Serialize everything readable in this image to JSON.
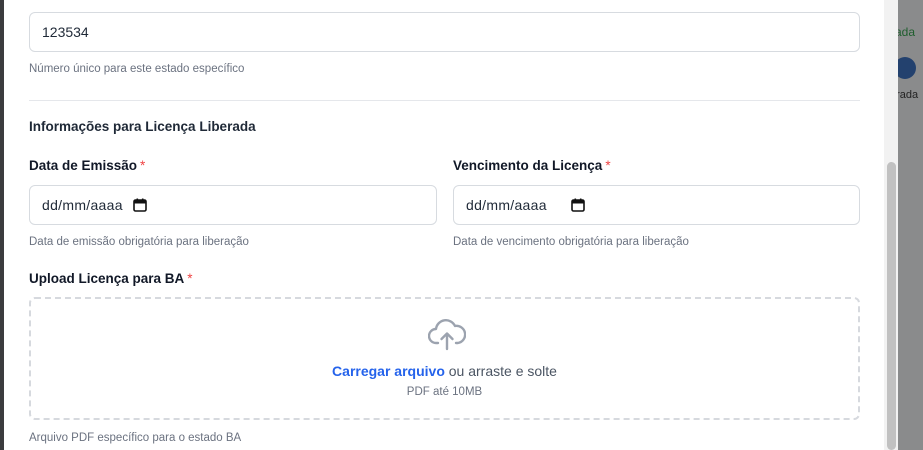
{
  "background": {
    "right_text_1": "ada",
    "right_text_2": "erada"
  },
  "state_field": {
    "value": "123534",
    "help": "Número único para este estado específico"
  },
  "section": {
    "title": "Informações para Licença Liberada"
  },
  "emission_date": {
    "label": "Data de Emissão",
    "required_mark": "*",
    "placeholder": "dd/mm/aaaa",
    "help": "Data de emissão obrigatória para liberação"
  },
  "expiry_date": {
    "label": "Vencimento da Licença",
    "required_mark": "*",
    "placeholder": "dd/mm/aaaa",
    "help": "Data de vencimento obrigatória para liberação"
  },
  "upload": {
    "label": "Upload Licença para BA",
    "required_mark": "*",
    "link_text": "Carregar arquivo",
    "drag_text": " ou arraste e solte",
    "constraint": "PDF até 10MB",
    "help": "Arquivo PDF específico para o estado BA"
  },
  "colors": {
    "link": "#2563eb",
    "required": "#ef4444",
    "border": "#d7dbe0"
  }
}
